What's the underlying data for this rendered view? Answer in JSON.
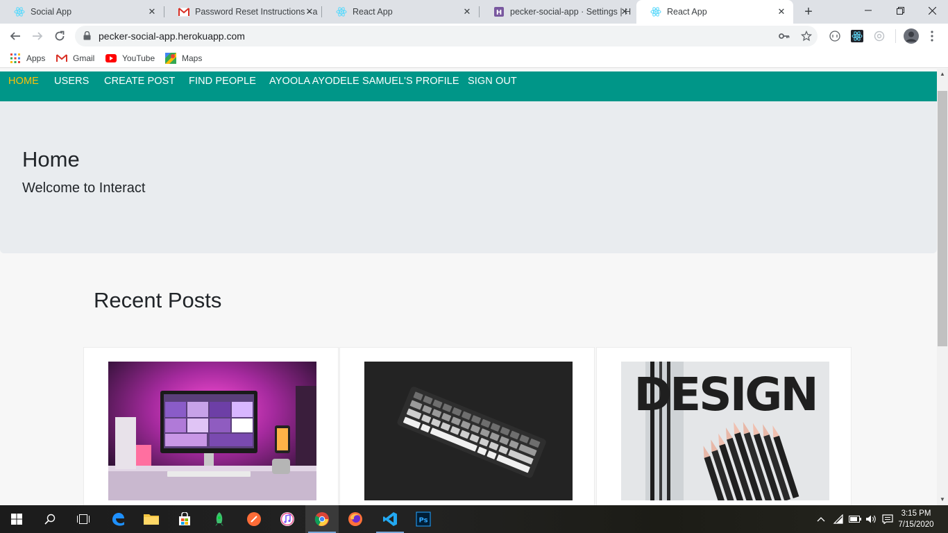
{
  "browser": {
    "tabs": [
      {
        "title": "Social App",
        "icon": "react-icon"
      },
      {
        "title": "Password Reset Instructions - a",
        "icon": "gmail-icon"
      },
      {
        "title": "React App",
        "icon": "react-icon"
      },
      {
        "title": "pecker-social-app · Settings | H",
        "icon": "heroku-icon"
      },
      {
        "title": "React App",
        "icon": "react-icon",
        "active": true
      }
    ],
    "url": "pecker-social-app.herokuapp.com",
    "bookmarks": [
      {
        "label": "Apps",
        "icon": "apps-grid-icon"
      },
      {
        "label": "Gmail",
        "icon": "gmail-icon"
      },
      {
        "label": "YouTube",
        "icon": "youtube-icon"
      },
      {
        "label": "Maps",
        "icon": "maps-icon"
      }
    ]
  },
  "app": {
    "nav": [
      {
        "label": "HOME",
        "active": true
      },
      {
        "label": "USERS"
      },
      {
        "label": "CREATE POST"
      },
      {
        "label": "FIND PEOPLE"
      },
      {
        "label": "AYOOLA AYODELE SAMUEL'S PROFILE"
      },
      {
        "label": "SIGN OUT"
      }
    ],
    "jumbotron": {
      "title": "Home",
      "subtitle": "Welcome to Interact"
    },
    "recent_heading": "Recent Posts",
    "posts": [
      {
        "image": "desk-setup-photo"
      },
      {
        "image": "keyboard-photo"
      },
      {
        "image": "design-pencils-photo",
        "image_text": "DESIGN"
      }
    ]
  },
  "taskbar": {
    "time": "3:15 PM",
    "date": "7/15/2020"
  },
  "colors": {
    "nav_bg": "#009688",
    "nav_active": "#ffc107",
    "jumbotron_bg": "#e9ecef"
  }
}
